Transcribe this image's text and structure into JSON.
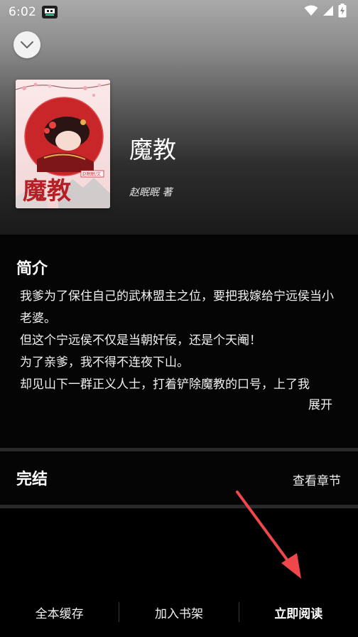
{
  "status_bar": {
    "time": "6:02",
    "icons": [
      "app-notification-icon",
      "wifi-icon",
      "signal-icon",
      "battery-charging-icon"
    ]
  },
  "header": {
    "collapse_icon": "chevron-down-icon"
  },
  "book": {
    "title": "魔教",
    "author": "赵眠眠 著",
    "cover": {
      "title_art": "魔教",
      "tag": "赵眠眠/文",
      "colors": {
        "background": "#f7e3e3",
        "circle": "#c9262a",
        "title": "#b51f25"
      }
    }
  },
  "intro": {
    "heading": "简介",
    "lines": [
      "我爹为了保住自己的武林盟主之位，要把我嫁给宁远侯当小老婆。",
      "但这个宁远侯不仅是当朝奸佞，还是个天阉！",
      "为了亲爹，我不得不连夜下山。",
      "却见山下一群正义人士，打着铲除魔教的口号，上了我"
    ],
    "expand_label": "展开"
  },
  "status": {
    "label": "完结",
    "chapters_label": "查看章节"
  },
  "bottom_bar": {
    "cache_label": "全本缓存",
    "shelf_label": "加入书架",
    "read_label": "立即阅读"
  },
  "colors": {
    "accent_arrow": "#f0484a",
    "background": "#000000",
    "divider": "#2a2a2a"
  }
}
